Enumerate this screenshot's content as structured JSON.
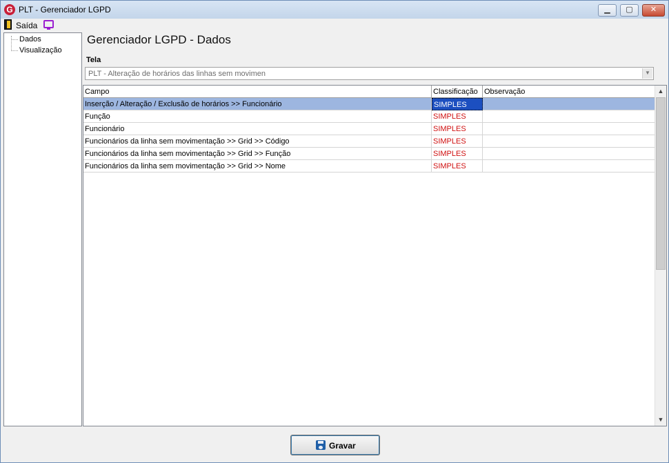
{
  "window": {
    "title": "PLT - Gerenciador LGPD",
    "app_icon_letter": "G"
  },
  "menu": {
    "saida_label": "Saída"
  },
  "tree": {
    "items": [
      {
        "label": "Dados"
      },
      {
        "label": "Visualização"
      }
    ]
  },
  "main": {
    "title": "Gerenciador LGPD - Dados",
    "tela_label": "Tela",
    "tela_value": "PLT - Alteração de horários das linhas sem movimen"
  },
  "grid": {
    "columns": [
      "Campo",
      "Classificação",
      "Observação"
    ],
    "rows": [
      {
        "campo": "Inserção / Alteração / Exclusão de horários >> Funcionário",
        "classificacao": "SIMPLES",
        "observacao": "",
        "selected": true
      },
      {
        "campo": "Função",
        "classificacao": "SIMPLES",
        "observacao": ""
      },
      {
        "campo": "Funcionário",
        "classificacao": "SIMPLES",
        "observacao": ""
      },
      {
        "campo": "Funcionários da linha sem movimentação >> Grid >> Código",
        "classificacao": "SIMPLES",
        "observacao": ""
      },
      {
        "campo": "Funcionários da linha sem movimentação >> Grid >> Função",
        "classificacao": "SIMPLES",
        "observacao": ""
      },
      {
        "campo": "Funcionários da linha sem movimentação >> Grid >> Nome",
        "classificacao": "SIMPLES",
        "observacao": ""
      }
    ]
  },
  "footer": {
    "save_label": "Gravar"
  },
  "colors": {
    "selection": "#9db6e0",
    "classification_text": "#d01010",
    "screen_icon": "#9b1fd0"
  },
  "icons": [
    "app-logo-icon",
    "exit-door-icon",
    "screen-icon",
    "save-disk-icon",
    "chevron-down-icon",
    "scroll-up-icon",
    "scroll-down-icon"
  ]
}
